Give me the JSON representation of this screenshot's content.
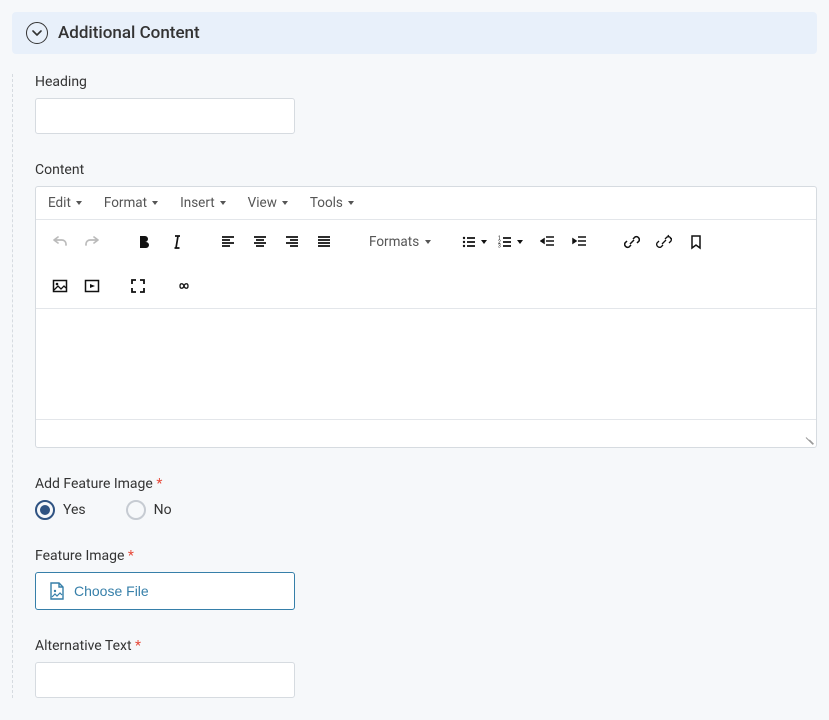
{
  "panel": {
    "title": "Additional Content"
  },
  "heading": {
    "label": "Heading",
    "value": ""
  },
  "content": {
    "label": "Content",
    "menus": {
      "edit": "Edit",
      "format": "Format",
      "insert": "Insert",
      "view": "View",
      "tools": "Tools"
    },
    "formats_label": "Formats",
    "value": ""
  },
  "featureImageToggle": {
    "label": "Add Feature Image",
    "options": {
      "yes": "Yes",
      "no": "No"
    },
    "selected": "yes"
  },
  "featureImage": {
    "label": "Feature Image",
    "button_label": "Choose File"
  },
  "altText": {
    "label": "Alternative Text",
    "value": ""
  }
}
